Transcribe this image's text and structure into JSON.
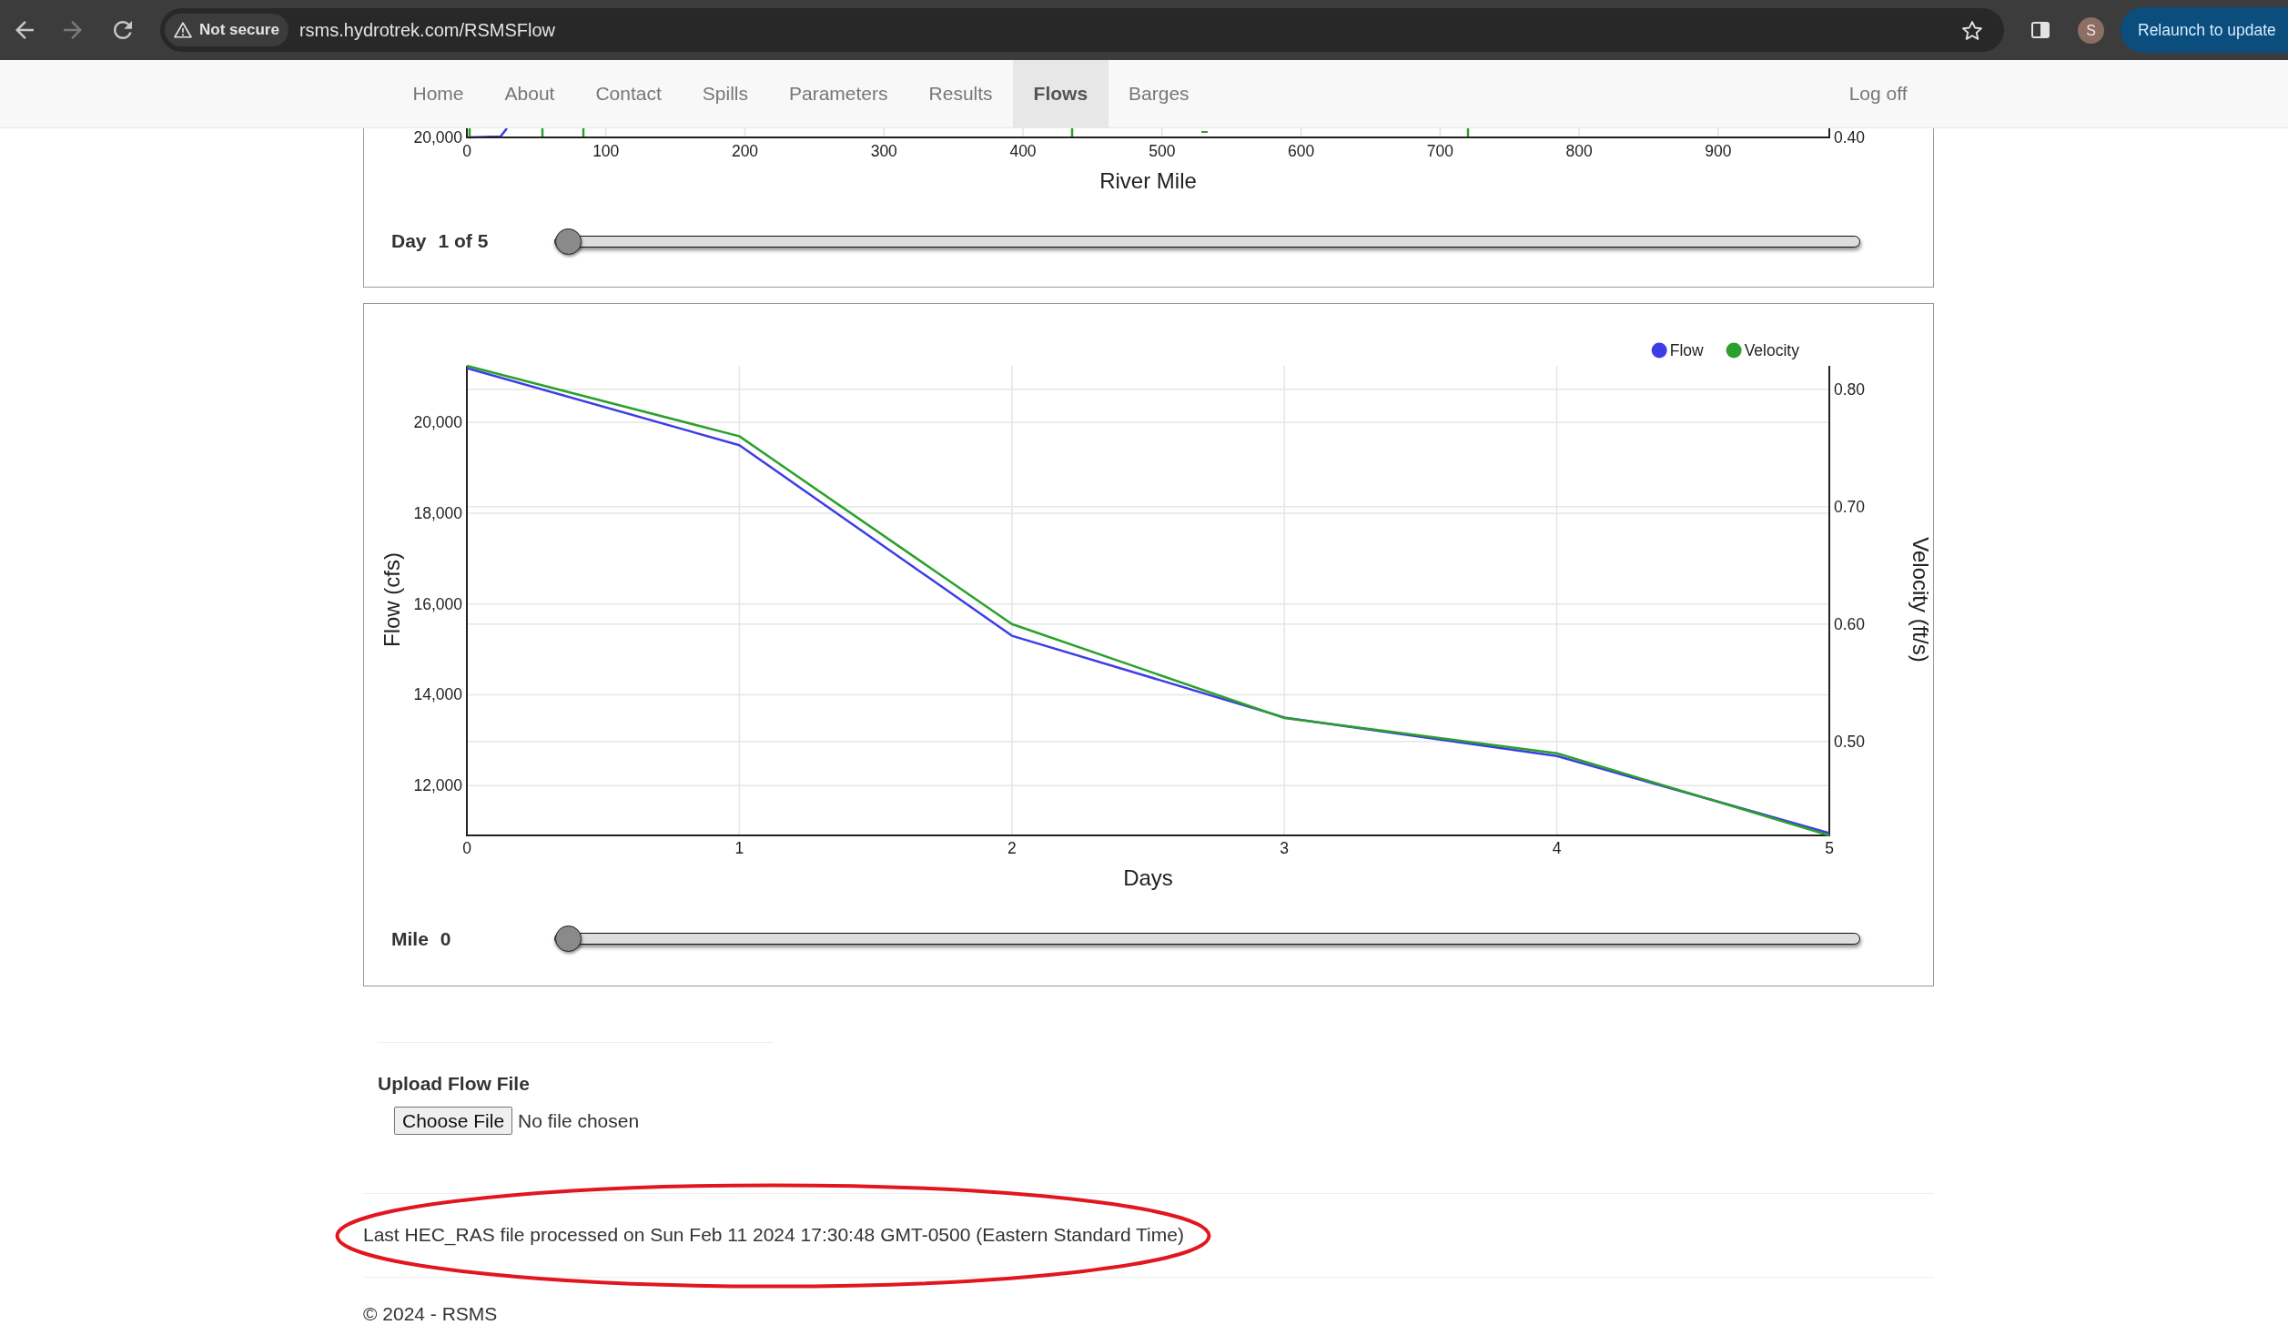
{
  "browser": {
    "nav_buttons": [
      {
        "kind": "back",
        "disabled": false
      },
      {
        "kind": "forward",
        "disabled": true
      },
      {
        "kind": "reload",
        "disabled": false
      }
    ],
    "security_label": "Not secure",
    "url": "rsms.hydrotrek.com/RSMSFlow",
    "profile_initial": "S",
    "update_button": "Relaunch to update"
  },
  "navbar": {
    "items": [
      {
        "label": "Home",
        "selected": false
      },
      {
        "label": "About",
        "selected": false
      },
      {
        "label": "Contact",
        "selected": false
      },
      {
        "label": "Spills",
        "selected": false
      },
      {
        "label": "Parameters",
        "selected": false
      },
      {
        "label": "Results",
        "selected": false
      },
      {
        "label": "Flows",
        "selected": true
      },
      {
        "label": "Barges",
        "selected": false
      }
    ],
    "log_off": "Log off"
  },
  "flow_profile": {
    "left_tick": "20,000",
    "right_tick": "0.40",
    "x_ticks": [
      "0",
      "100",
      "200",
      "300",
      "400",
      "500",
      "600",
      "700",
      "800",
      "900"
    ],
    "x_title": "River Mile",
    "slider": {
      "label": "Day",
      "value": "1 of 5",
      "level": 0
    }
  },
  "time_series": {
    "chart_data": {
      "type": "line",
      "xlabel": "Days",
      "ylabel": "Flow (cfs)",
      "y2label": "Velocity (ft/s)",
      "x": [
        0,
        1,
        2,
        3,
        4,
        5
      ],
      "series": [
        {
          "name": "Flow",
          "color": "#3d3de6",
          "values": [
            21200,
            19500,
            15300,
            13500,
            12650,
            10950
          ]
        },
        {
          "name": "Velocity",
          "color": "#2ca02c",
          "axis": "y2",
          "values": [
            0.82,
            0.76,
            0.6,
            0.52,
            0.49,
            0.42
          ]
        }
      ],
      "xlim": [
        0,
        5
      ],
      "ylim": [
        10900,
        21250
      ],
      "y2lim": [
        0.42,
        0.82
      ],
      "xticks": [
        0,
        1,
        2,
        3,
        4,
        5
      ],
      "yticks": [
        {
          "value": 12000,
          "label": "12,000"
        },
        {
          "value": 14000,
          "label": "14,000"
        },
        {
          "value": 16000,
          "label": "16,000"
        },
        {
          "value": 18000,
          "label": "18,000"
        },
        {
          "value": 20000,
          "label": "20,000"
        }
      ],
      "y2ticks": [
        {
          "value": 0.5,
          "label": "0.50"
        },
        {
          "value": 0.6,
          "label": "0.60"
        },
        {
          "value": 0.7,
          "label": "0.70"
        },
        {
          "value": 0.8,
          "label": "0.80"
        }
      ],
      "grid": true,
      "legend": "upper right"
    },
    "slider": {
      "label": "Mile",
      "value": "0",
      "level": 0
    }
  },
  "upload": {
    "title": "Upload Flow File",
    "button": "Choose File",
    "status": "No file chosen"
  },
  "last_processed": {
    "text": "Last HEC_RAS file processed on Sun Feb 11 2024 17:30:48 GMT-0500 (Eastern Standard Time)",
    "circled": true
  },
  "footer": {
    "copyright": "© 2024 - RSMS"
  }
}
